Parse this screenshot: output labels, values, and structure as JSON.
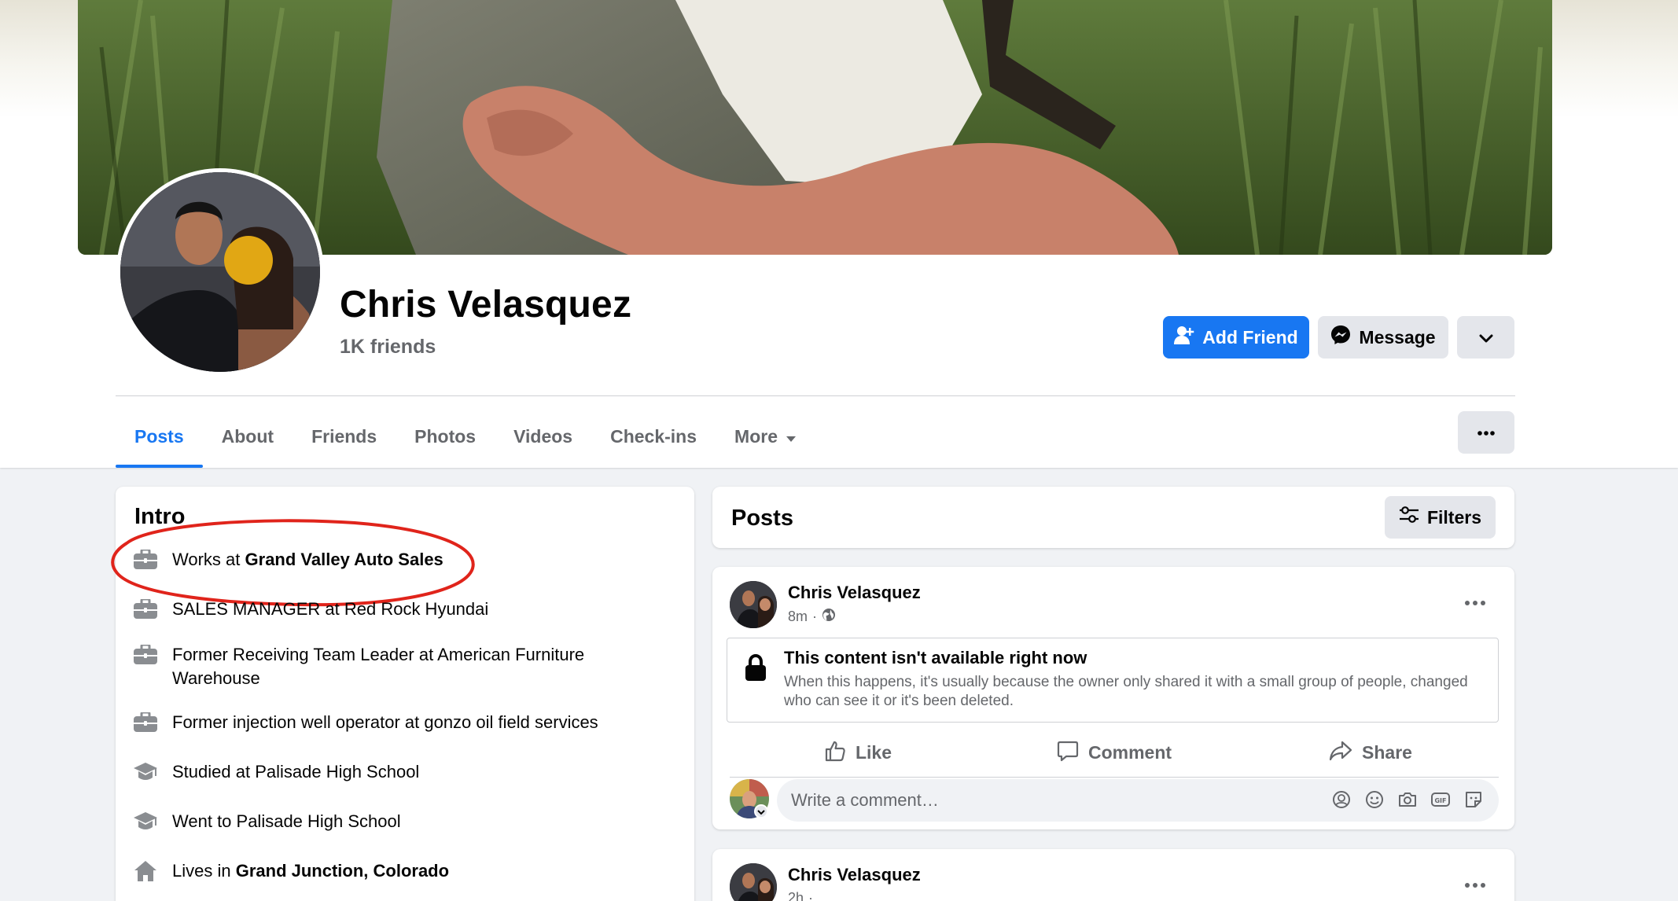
{
  "profile": {
    "name": "Chris Velasquez",
    "friends": "1K friends"
  },
  "actions": {
    "add_friend": "Add Friend",
    "message": "Message"
  },
  "tabs": [
    {
      "label": "Posts",
      "active": true
    },
    {
      "label": "About"
    },
    {
      "label": "Friends"
    },
    {
      "label": "Photos"
    },
    {
      "label": "Videos"
    },
    {
      "label": "Check-ins"
    },
    {
      "label": "More"
    }
  ],
  "intro": {
    "title": "Intro",
    "items": [
      {
        "icon": "briefcase-icon",
        "prefix": "Works at ",
        "bold": "Grand Valley Auto Sales",
        "highlighted": true
      },
      {
        "icon": "briefcase-icon",
        "prefix": "SALES MANAGER at Red Rock Hyundai",
        "bold": ""
      },
      {
        "icon": "briefcase-icon",
        "prefix": "Former Receiving Team Leader at American Furniture Warehouse",
        "bold": ""
      },
      {
        "icon": "briefcase-icon",
        "prefix": "Former injection well operator at gonzo oil field services",
        "bold": ""
      },
      {
        "icon": "graduation-cap-icon",
        "prefix": "Studied at Palisade High School",
        "bold": ""
      },
      {
        "icon": "graduation-cap-icon",
        "prefix": "Went to Palisade High School",
        "bold": ""
      },
      {
        "icon": "home-icon",
        "prefix": "Lives in ",
        "bold": "Grand Junction, Colorado"
      }
    ]
  },
  "posts_section": {
    "title": "Posts",
    "filters": "Filters"
  },
  "posts": [
    {
      "author": "Chris Velasquez",
      "time": "8m",
      "unavailable_title": "This content isn't available right now",
      "unavailable_body": "When this happens, it's usually because the owner only shared it with a small group of people, changed who can see it or it's been deleted.",
      "like": "Like",
      "comment": "Comment",
      "share": "Share",
      "comment_placeholder": "Write a comment…"
    },
    {
      "author": "Chris Velasquez",
      "time": "2h"
    }
  ],
  "colors": {
    "accent": "#1877f2",
    "highlight_circle": "#e0241b",
    "face_blur": "#e1a714"
  }
}
